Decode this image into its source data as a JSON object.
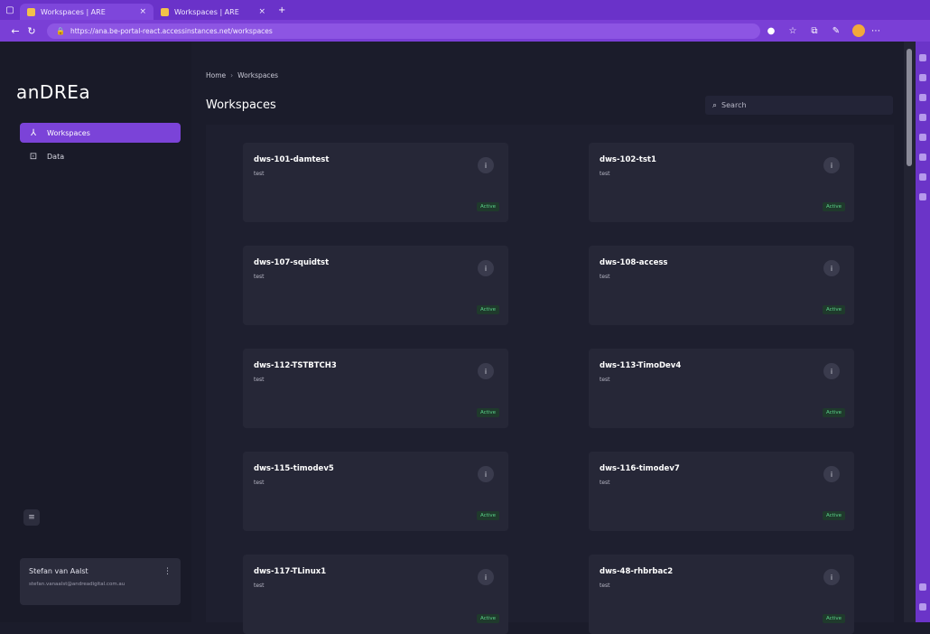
{
  "browser": {
    "tabs": [
      {
        "title": "Workspaces | ARE",
        "active": true
      },
      {
        "title": "Workspaces | ARE",
        "active": false
      }
    ],
    "url": "https://ana.be-portal-react.accessinstances.net/workspaces"
  },
  "sidebar": {
    "logo_text": "anDREa",
    "items": [
      {
        "label": "Workspaces",
        "icon": "workspaces-icon",
        "active": true
      },
      {
        "label": "Data",
        "icon": "data-icon",
        "active": false
      }
    ],
    "user": {
      "name": "Stefan van Aalst",
      "email": "stefan.vanaalst@andreadigital.com.au"
    }
  },
  "main": {
    "breadcrumb": [
      "Home",
      "Workspaces"
    ],
    "title": "Workspaces",
    "search_placeholder": "Search"
  },
  "workspaces": [
    {
      "name": "dws-101-damtest",
      "sub": "test",
      "status": "Active"
    },
    {
      "name": "dws-102-tst1",
      "sub": "test",
      "status": "Active"
    },
    {
      "name": "dws-107-squidtst",
      "sub": "test",
      "status": "Active"
    },
    {
      "name": "dws-108-access",
      "sub": "test",
      "status": "Active"
    },
    {
      "name": "dws-112-TSTBTCH3",
      "sub": "test",
      "status": "Active"
    },
    {
      "name": "dws-113-TimoDev4",
      "sub": "test",
      "status": "Active"
    },
    {
      "name": "dws-115-timodev5",
      "sub": "test",
      "status": "Active"
    },
    {
      "name": "dws-116-timodev7",
      "sub": "test",
      "status": "Active"
    },
    {
      "name": "dws-117-TLinux1",
      "sub": "test",
      "status": "Active"
    },
    {
      "name": "dws-48-rhbrbac2",
      "sub": "test",
      "status": "Active"
    }
  ]
}
